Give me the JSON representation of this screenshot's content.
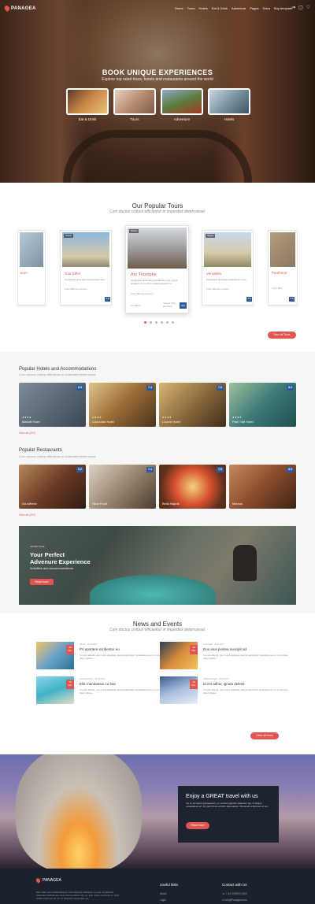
{
  "brand": "PANAGEA",
  "nav": [
    "Home",
    "Tours",
    "Hotels",
    "Eat & Drink",
    "Adventure",
    "Pages",
    "Extra",
    "Buy template"
  ],
  "hero": {
    "title": "BOOK UNIQUE EXPERIENCES",
    "subtitle": "Explore top rated tours, hotels and restaurants around the world",
    "categories": [
      "Eat & Drink",
      "Tours",
      "Adventure",
      "Hotels"
    ]
  },
  "tours": {
    "title": "Our Popular Tours",
    "subtitle": "Cum doctus civibus efficiantur in imperdiet deterruisset.",
    "items": [
      {
        "name": "eum",
        "score": ""
      },
      {
        "name": "Tour Eiffel",
        "tag": "Historic",
        "score": "7.8",
        "price": "From $54 /per person"
      },
      {
        "name": "Arc Triomphe",
        "tag": "Historic",
        "score": "9.9",
        "text": "Id placerat tacimates definitionem sea, prima quidam vim no. Duo nobis persecuti cu.",
        "price": "From $54 /per person",
        "duration": "1h 30min",
        "rating": "Superb 350 Reviews"
      },
      {
        "name": "Versailles",
        "tag": "Historic",
        "score": "7.5",
        "price": "From $54 /per person"
      },
      {
        "name": "Pantheon",
        "score": "7.5",
        "price": "From $54"
      }
    ],
    "view_all": "View all Tours"
  },
  "hotels": {
    "title": "Popular Hotels and Accommodations",
    "subtitle": "Cum doctus civibus efficiantur in imperdiet deterruisset.",
    "items": [
      {
        "name": "Mariott Hotel",
        "score": "8.9",
        "stars": "★★★★"
      },
      {
        "name": "Concorde Hotel",
        "score": "7.4",
        "stars": "★★★★"
      },
      {
        "name": "Louvre Hotel",
        "score": "7.8",
        "stars": "★★★★"
      },
      {
        "name": "Park Yatt Hotel",
        "score": "8.9",
        "stars": "★★★★"
      }
    ],
    "view_all": "View all (157)"
  },
  "restaurants": {
    "title": "Popular Restaurants",
    "subtitle": "Cum doctus civibus efficiantur in imperdiet deterruisset.",
    "items": [
      {
        "name": "Da Alfredo",
        "score": "9.2"
      },
      {
        "name": "Slow Food",
        "score": "7.4"
      },
      {
        "name": "Bella Napoli",
        "score": "7.8"
      },
      {
        "name": "Marcus",
        "score": "8.9"
      }
    ],
    "view_all": "View all (157)"
  },
  "banner": {
    "kicker": "ADVENTURE",
    "title1": "Your Perfect",
    "title2": "Advenure Experience",
    "sub": "Activities and accommodations",
    "cta": "Read more"
  },
  "news": {
    "title": "News and Events",
    "subtitle": "Cum doctus civibus efficiantur in imperdiet deterruisset.",
    "items": [
      {
        "day": "28",
        "mon": "Dec",
        "meta": "Admin · 20.11.2017",
        "title": "Pri oportere scribentur eu",
        "text": "Cu eum alia elit, usu in eius appareat, deleniti sapientem honestatis eos ex. In ius esse ullum vidisse...."
      },
      {
        "day": "28",
        "mon": "Dec",
        "meta": "Luca Gatti · 20.11.2017",
        "title": "Duo eius postea suscipit ad",
        "text": "Cu eum alia elit, usu in eius appareat, deleniti sapientem honestatis eos ex. In ius esse ullum vidisse...."
      },
      {
        "day": "28",
        "mon": "Dec",
        "meta": "Luca Robinson · 20.11.2017",
        "title": "Elitr mandamus cu has",
        "text": "Cu eum alia elit, usu in eius appareat, deleniti sapientem honestatis eos ex. In ius esse ullum vidisse...."
      },
      {
        "day": "28",
        "mon": "Dec",
        "meta": "Paula Rodrigez · 20.11.2017",
        "title": "Id est adhuc ignota delenit",
        "text": "Cu eum alia elit, usu in eius appareat, deleniti sapientem honestatis eos ex. In ius esse ullum vidisse...."
      }
    ],
    "view_all": "View all news"
  },
  "promo": {
    "title": "Enjoy a GREAT travel with us",
    "text": "Ius cu tamquam persequeris, eu veniam apeirian platonem qui, id aliquip voluptatibus pri. Ei mea primis ornatus disputationi. Menandri scriptorem ei est.",
    "cta": "Read more"
  },
  "footer": {
    "text": "Mea nibh meis philosophia eu. Duis legimus efficiantur ea sea. Id placerat tacimates definitionem sea, prima quidam vim no. Duo nobis persecuti cu. Nihil facilisi indoctum an vix, ut delectus expetendis vis.",
    "col1": "Useful links",
    "link1": "About",
    "link2": "Login",
    "col2": "Contact with Us",
    "phone": "+ 61 23 8093 3400",
    "email": "info@Panagea.com"
  },
  "colors": {
    "accent": "#e05550",
    "score": "#2d5b9b"
  }
}
